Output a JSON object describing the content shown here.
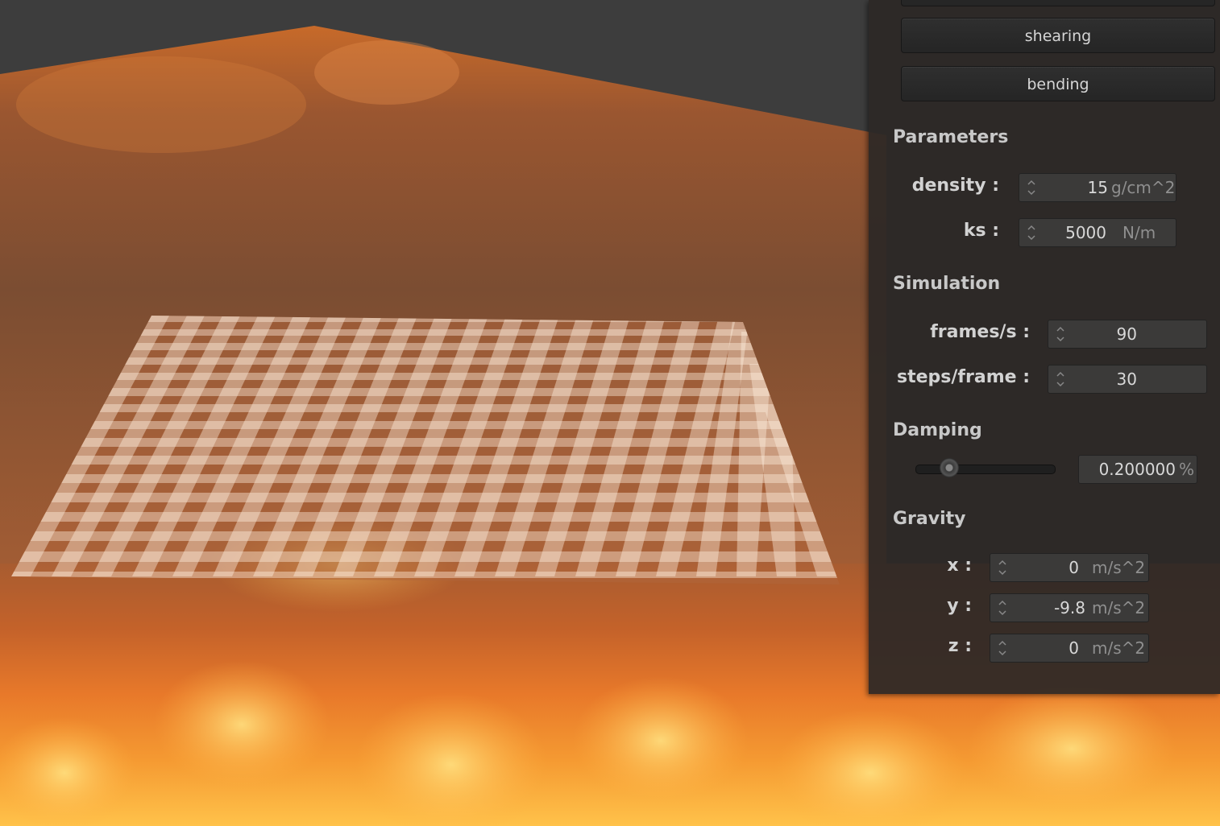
{
  "panel": {
    "buttons": {
      "shearing": "shearing",
      "bending": "bending"
    },
    "parameters": {
      "title": "Parameters",
      "density": {
        "label": "density :",
        "value": "15",
        "unit": "g/cm^2"
      },
      "ks": {
        "label": "ks :",
        "value": "5000",
        "unit": "N/m"
      }
    },
    "simulation": {
      "title": "Simulation",
      "fps": {
        "label": "frames/s :",
        "value": "90"
      },
      "steps": {
        "label": "steps/frame :",
        "value": "30"
      }
    },
    "damping": {
      "title": "Damping",
      "value": "0.200000",
      "unit": "%",
      "slider_level": 0.2
    },
    "gravity": {
      "title": "Gravity",
      "x": {
        "label": "x :",
        "value": "0",
        "unit": "m/s^2"
      },
      "y": {
        "label": "y :",
        "value": "-9.8",
        "unit": "m/s^2"
      },
      "z": {
        "label": "z :",
        "value": "0",
        "unit": "m/s^2"
      }
    }
  },
  "colors": {
    "panel_bg": "#2c2826",
    "fire_bright": "#ffd060",
    "fire_dark": "#8a3c18"
  },
  "icons": {
    "spin_arrows": "up-down-arrows-icon",
    "slider": "slider-knob-icon"
  }
}
